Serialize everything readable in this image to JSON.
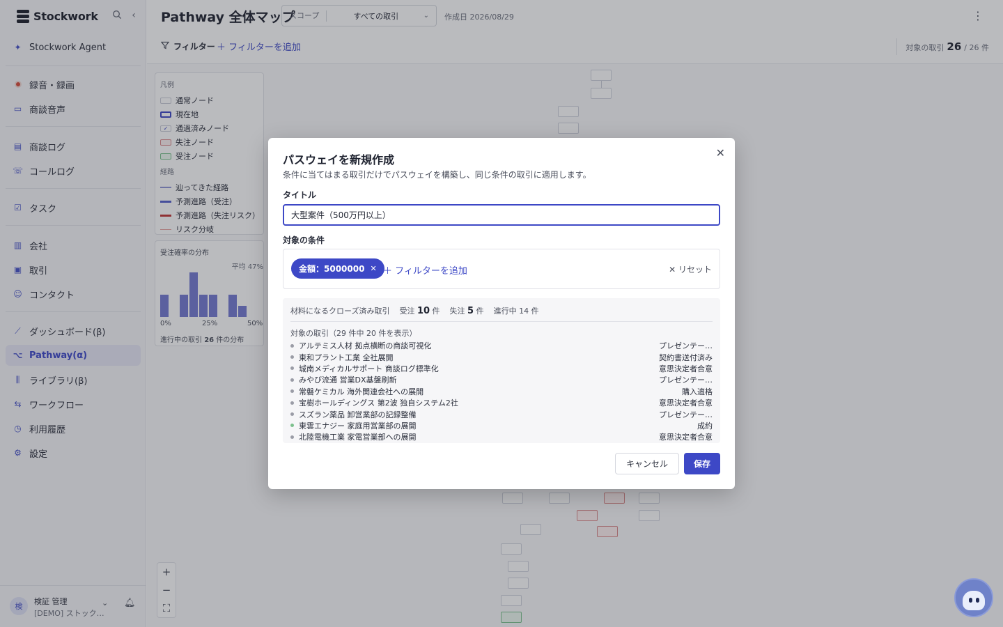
{
  "sidebar": {
    "brand": "Stockwork",
    "agent": "Stockwork Agent",
    "items": [
      {
        "label": "録音・録画",
        "icon": "record-icon"
      },
      {
        "label": "商談音声",
        "icon": "folder-icon"
      },
      {
        "label": "商談ログ",
        "icon": "document-icon"
      },
      {
        "label": "コールログ",
        "icon": "phone-icon"
      },
      {
        "label": "タスク",
        "icon": "checkbox-icon"
      },
      {
        "label": "会社",
        "icon": "building-icon"
      },
      {
        "label": "取引",
        "icon": "briefcase-icon"
      },
      {
        "label": "コンタクト",
        "icon": "contact-icon"
      },
      {
        "label": "ダッシュボード(β)",
        "icon": "chart-icon"
      },
      {
        "label": "Pathway(α)",
        "icon": "pathway-icon"
      },
      {
        "label": "ライブラリ(β)",
        "icon": "library-icon"
      },
      {
        "label": "ワークフロー",
        "icon": "workflow-icon"
      },
      {
        "label": "利用履歴",
        "icon": "history-icon"
      },
      {
        "label": "設定",
        "icon": "gear-icon"
      }
    ],
    "user": {
      "avatar": "検",
      "name": "検証 管理",
      "org": "[DEMO] ストック…"
    }
  },
  "header": {
    "title": "Pathway 全体マップ",
    "scope_label": "スコープ",
    "scope_value": "すべての取引",
    "created": "作成日 2026/08/29"
  },
  "filterbar": {
    "filter_label": "フィルター",
    "add_filter": "＋ フィルターを追加",
    "count_label": "対象の取引",
    "count_value": "26",
    "count_total": "/ 26 件"
  },
  "legend": {
    "title": "凡例",
    "nodes": [
      "通常ノード",
      "現在地",
      "通過済みノード",
      "失注ノード",
      "受注ノード"
    ],
    "routes_title": "経路",
    "routes": [
      {
        "label": "辿ってきた経路",
        "color": "#8f95d6"
      },
      {
        "label": "予測進路（受注）",
        "color": "#5560cc"
      },
      {
        "label": "予測進路（失注リスク）",
        "color": "#c23434"
      },
      {
        "label": "リスク分岐",
        "color": "#e8a3a0"
      }
    ]
  },
  "distribution": {
    "title": "受注確率の分布",
    "avg": "平均 47%",
    "ticks": [
      "0%",
      "25%",
      "50%"
    ],
    "values": [
      0.5,
      0,
      0.5,
      1.0,
      0.5,
      0.5,
      0,
      0.5,
      0.25
    ],
    "footer_prefix": "進行中の取引",
    "footer_count": "26",
    "footer_suffix": "件の分布"
  },
  "modal": {
    "title": "パスウェイを新規作成",
    "description": "条件に当てはまる取引だけでパスウェイを構築し、同じ条件の取引に適用します。",
    "title_label": "タイトル",
    "title_value": "大型案件（500万円以上）",
    "condition_label": "対象の条件",
    "chip": "金額：5000000",
    "add_filter": "＋ フィルターを追加",
    "reset": "✕ リセット",
    "stats": {
      "source_label": "材料になるクローズ済み取引",
      "won_prefix": "受注",
      "won_count": "10",
      "won_suffix": "件",
      "lost_prefix": "失注",
      "lost_count": "5",
      "lost_suffix": "件",
      "open": "進行中 14 件"
    },
    "list_heading": "対象の取引（29 件中 20 件を表示）",
    "deals": [
      {
        "name": "アルテミス人材 拠点横断の商談可視化",
        "stage": "プレゼンテー…",
        "won": false
      },
      {
        "name": "東和プラント工業 全社展開",
        "stage": "契約書送付済み",
        "won": false
      },
      {
        "name": "城南メディカルサポート 商談ログ標準化",
        "stage": "意思決定者合意",
        "won": false
      },
      {
        "name": "みやび流通 営業DX基盤刷新",
        "stage": "プレゼンテー…",
        "won": false
      },
      {
        "name": "常磐ケミカル 海外関連会社への展開",
        "stage": "購入適格",
        "won": false
      },
      {
        "name": "宝樹ホールディングス 第2波 独自システム2社",
        "stage": "意思決定者合意",
        "won": false
      },
      {
        "name": "スズラン薬品 卸営業部の記録整備",
        "stage": "プレゼンテー…",
        "won": false
      },
      {
        "name": "東雲エナジー 家庭用営業部の展開",
        "stage": "成約",
        "won": true
      },
      {
        "name": "北陸電機工業 家電営業部への展開",
        "stage": "意思決定者合意",
        "won": false
      }
    ],
    "cancel": "キャンセル",
    "save": "保存"
  }
}
